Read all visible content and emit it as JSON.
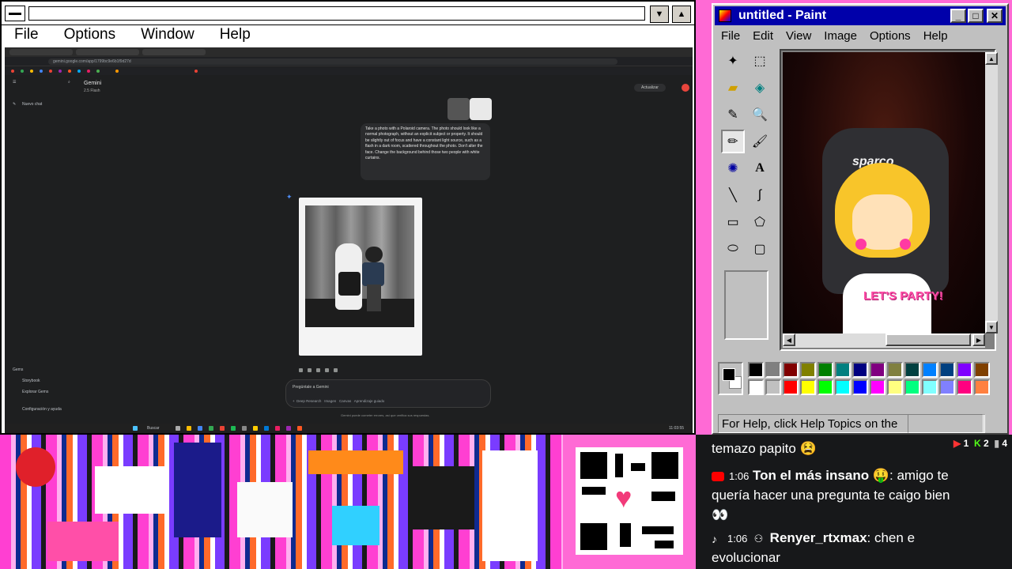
{
  "left_window": {
    "menu": [
      "File",
      "Options",
      "Window",
      "Help"
    ],
    "browser": {
      "url": "gemini.google.com/app/1799bc9e6b1f9d27d",
      "title": "Gemini",
      "model": "2.5 Flash",
      "upgrade": "Actualizar",
      "sidebar": {
        "new_chat": "Nuevo chat",
        "gems": "Gems",
        "storybook": "Storybook",
        "explore_gems": "Explorar Gems",
        "settings": "Configuración y ayuda"
      },
      "prompt_text": "Take a photo with a Polaroid camera. The photo should look like a normal photograph, without an explicit subject or property. It should be slightly out of focus and have a constant light source, such as a flash in a dark room, scattered throughout the photo. Don't alter the face. Change the background behind those two people with white curtains.",
      "input_placeholder": "Pregúntale a Gemini",
      "tools": [
        "Deep Research",
        "Imagen",
        "Canvas",
        "Aprendizaje guiado"
      ],
      "disclaimer": "Gemini puede cometer errores, así que verifica sus respuestas.",
      "taskbar_search": "Buscar",
      "clock": "11:03:55"
    }
  },
  "paint": {
    "title": "untitled - Paint",
    "menu": [
      "File",
      "Edit",
      "View",
      "Image",
      "Options",
      "Help"
    ],
    "status": "For Help, click Help Topics on the",
    "chair_brand": "sparco",
    "shirt_text": "LET'S PARTY!",
    "palette_top": [
      "#000000",
      "#808080",
      "#800000",
      "#808000",
      "#008000",
      "#008080",
      "#000080",
      "#800080",
      "#808040",
      "#004040",
      "#0080ff",
      "#004080",
      "#8000ff",
      "#804000"
    ],
    "palette_bottom": [
      "#ffffff",
      "#c0c0c0",
      "#ff0000",
      "#ffff00",
      "#00ff00",
      "#00ffff",
      "#0000ff",
      "#ff00ff",
      "#ffff80",
      "#00ff80",
      "#80ffff",
      "#8080ff",
      "#ff0080",
      "#ff8040"
    ]
  },
  "chat": {
    "badges": {
      "yt": "1",
      "kick": "2",
      "other": "4"
    },
    "lines": [
      {
        "time": "",
        "user": "",
        "text": "temazo papito 😫"
      },
      {
        "time": "1:06",
        "user": "Ton el más insano",
        "text": "🤑: amigo te"
      },
      {
        "time": "",
        "user": "",
        "text": "quería hacer una pregunta te caigo bien"
      },
      {
        "time": "",
        "user": "",
        "text": "👀"
      },
      {
        "time": "1:06",
        "user": "Renyer_rtxmax",
        "text": ": chen e"
      },
      {
        "time": "",
        "user": "",
        "text": "evolucionar"
      }
    ]
  }
}
